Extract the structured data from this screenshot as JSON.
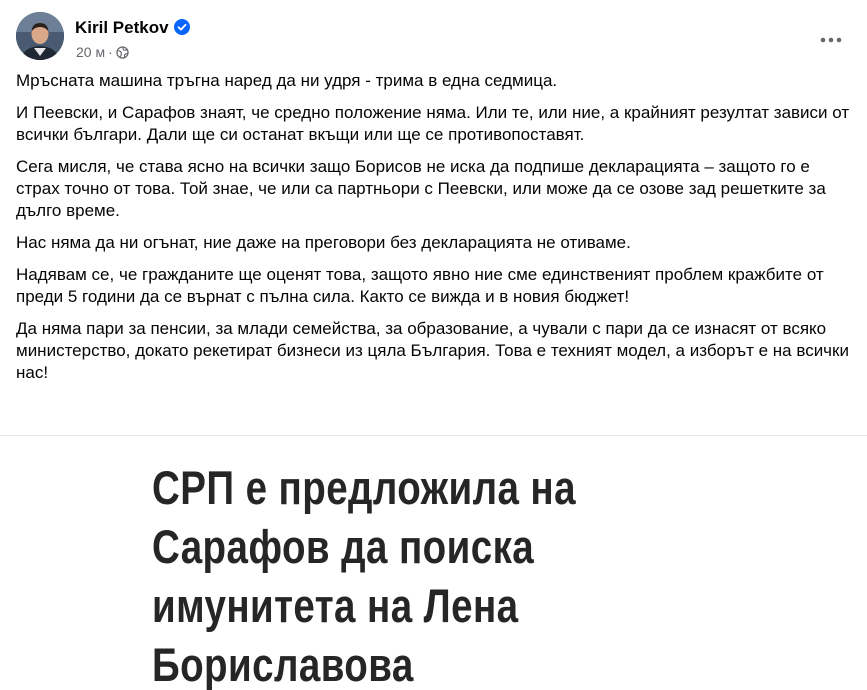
{
  "author": {
    "name": "Kiril Petkov",
    "verified": true
  },
  "meta": {
    "time": "20 м",
    "separator": "·",
    "audience_icon": "globe-icon"
  },
  "menu": {
    "icon": "more-options-icon"
  },
  "post": {
    "paragraphs": [
      "Мръсната машина тръгна наред да ни удря - трима в една седмица.",
      "И Пеевски, и Сарафов знаят, че средно положение няма. Или те, или ние, а крайният резултат зависи от всички българи. Дали ще си останат вкъщи или ще се противопоставят.",
      "Сега мисля, че става ясно на всички защо Борисов не иска да подпише декларацията – защото го е страх точно от това. Той знае, че или са партньори с Пеевски, или може да се озове зад решетките за дълго време.",
      "Нас няма да ни огънат, ние даже на преговори без декларацията не отиваме.",
      "Надявам се, че гражданите ще оценят това, защото явно ние сме единственият проблем кражбите от преди 5 години да се върнат с пълна сила. Както се вижда и в новия бюджет!",
      "Да няма пари за пенсии, за млади семейства, за образование, а чували с пари да се изнасят от всяко министерство, докато рекетират бизнеси из цяла България.  Това е техният модел, а изборът е на всички нас!"
    ]
  },
  "image": {
    "headline_lines": [
      "СРП е предложила на",
      "Сарафов да поиска",
      "имунитета на Лена",
      "Бориславова"
    ]
  },
  "colors": {
    "text": "#050505",
    "secondary": "#65676b",
    "verified_blue": "#0866ff",
    "headline": "#262626"
  }
}
